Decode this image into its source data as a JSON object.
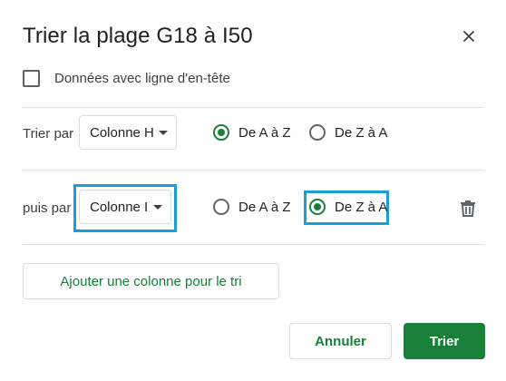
{
  "dialog": {
    "title": "Trier la plage G18 à I50",
    "close_icon": "close-icon"
  },
  "header_checkbox": {
    "label": "Données avec ligne d'en-tête",
    "checked": false
  },
  "sort_rows": [
    {
      "label": "Trier par",
      "column": "Colonne H",
      "options": [
        "De A à Z",
        "De Z à A"
      ],
      "selected": "De A à Z"
    },
    {
      "label": "puis par",
      "column": "Colonne I",
      "options": [
        "De A à Z",
        "De Z à A"
      ],
      "selected": "De Z à A",
      "delete_icon": "trash-icon"
    }
  ],
  "add_column_label": "Ajouter une colonne pour le tri",
  "buttons": {
    "cancel": "Annuler",
    "confirm": "Trier"
  },
  "colors": {
    "accent": "#188038",
    "highlight": "#1a9fd8"
  }
}
